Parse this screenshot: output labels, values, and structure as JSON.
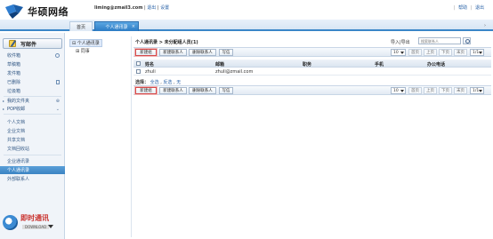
{
  "brand": {
    "name": "华硕网络"
  },
  "header": {
    "user": "liming@zmail3.com",
    "links": [
      "退出",
      "设置"
    ],
    "right_links": [
      "帮助",
      "退出"
    ]
  },
  "tabs": [
    {
      "label": "首页",
      "active": false
    },
    {
      "label": "个人通讯录",
      "active": true,
      "close": "×"
    }
  ],
  "sidebar": {
    "compose_label": "写邮件",
    "mail_items": [
      "收件箱",
      "草稿箱",
      "发件箱",
      "已删除",
      "垃圾箱"
    ],
    "sections": [
      "我的文件夹",
      "POP收邮"
    ],
    "doc_items": [
      "个人文档",
      "企业文档",
      "共享文档",
      "文档回收站"
    ],
    "contact_items": [
      "企业通讯录",
      "个人通讯录",
      "外部联系人"
    ],
    "active_item": "个人通讯录"
  },
  "im_widget": {
    "title": "即时通讯",
    "sub": "DOWNLOAD"
  },
  "tree": {
    "items": [
      "个人通讯录",
      "同事"
    ]
  },
  "content": {
    "title": "个人通讯录 > 未分配组人员(1)",
    "import_label": "导入|导出",
    "search_placeholder": "搜索联系人",
    "toolbar": {
      "buttons": [
        "新建组",
        "新建联系人",
        "删除联系人",
        "写信"
      ]
    },
    "pager": {
      "per_page": "10",
      "links": [
        "首页",
        "上页",
        "下页",
        "末页"
      ],
      "page": "1/1"
    },
    "columns": [
      "姓名",
      "邮箱",
      "职务",
      "手机",
      "办公电话"
    ],
    "rows": [
      {
        "name": "zhuli",
        "email": "zhuli@zmail.com",
        "title": "",
        "mobile": "",
        "office": ""
      }
    ],
    "select_label": "选择：",
    "select_links": [
      "全选",
      "反选",
      "无"
    ]
  }
}
